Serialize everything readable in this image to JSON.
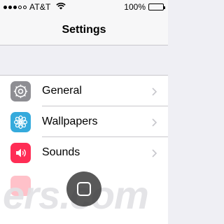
{
  "status_bar": {
    "carrier": "AT&T",
    "battery_percent": "100%",
    "battery_level": 1.0,
    "signal_bars_filled": 3,
    "signal_bars_total": 5
  },
  "nav": {
    "title": "Settings"
  },
  "settings": {
    "items": [
      {
        "label": "General",
        "icon": "gear-icon",
        "color": "#8e8e93"
      },
      {
        "label": "Wallpapers",
        "icon": "flower-icon",
        "color": "#35aadc"
      },
      {
        "label": "Sounds",
        "icon": "speaker-icon",
        "color": "#ff2d55"
      }
    ]
  },
  "watermark": {
    "text": "ers.com"
  },
  "colors": {
    "background": "#efeff4",
    "separator": "#c8c7cc",
    "chevron": "#c7c7cc"
  }
}
